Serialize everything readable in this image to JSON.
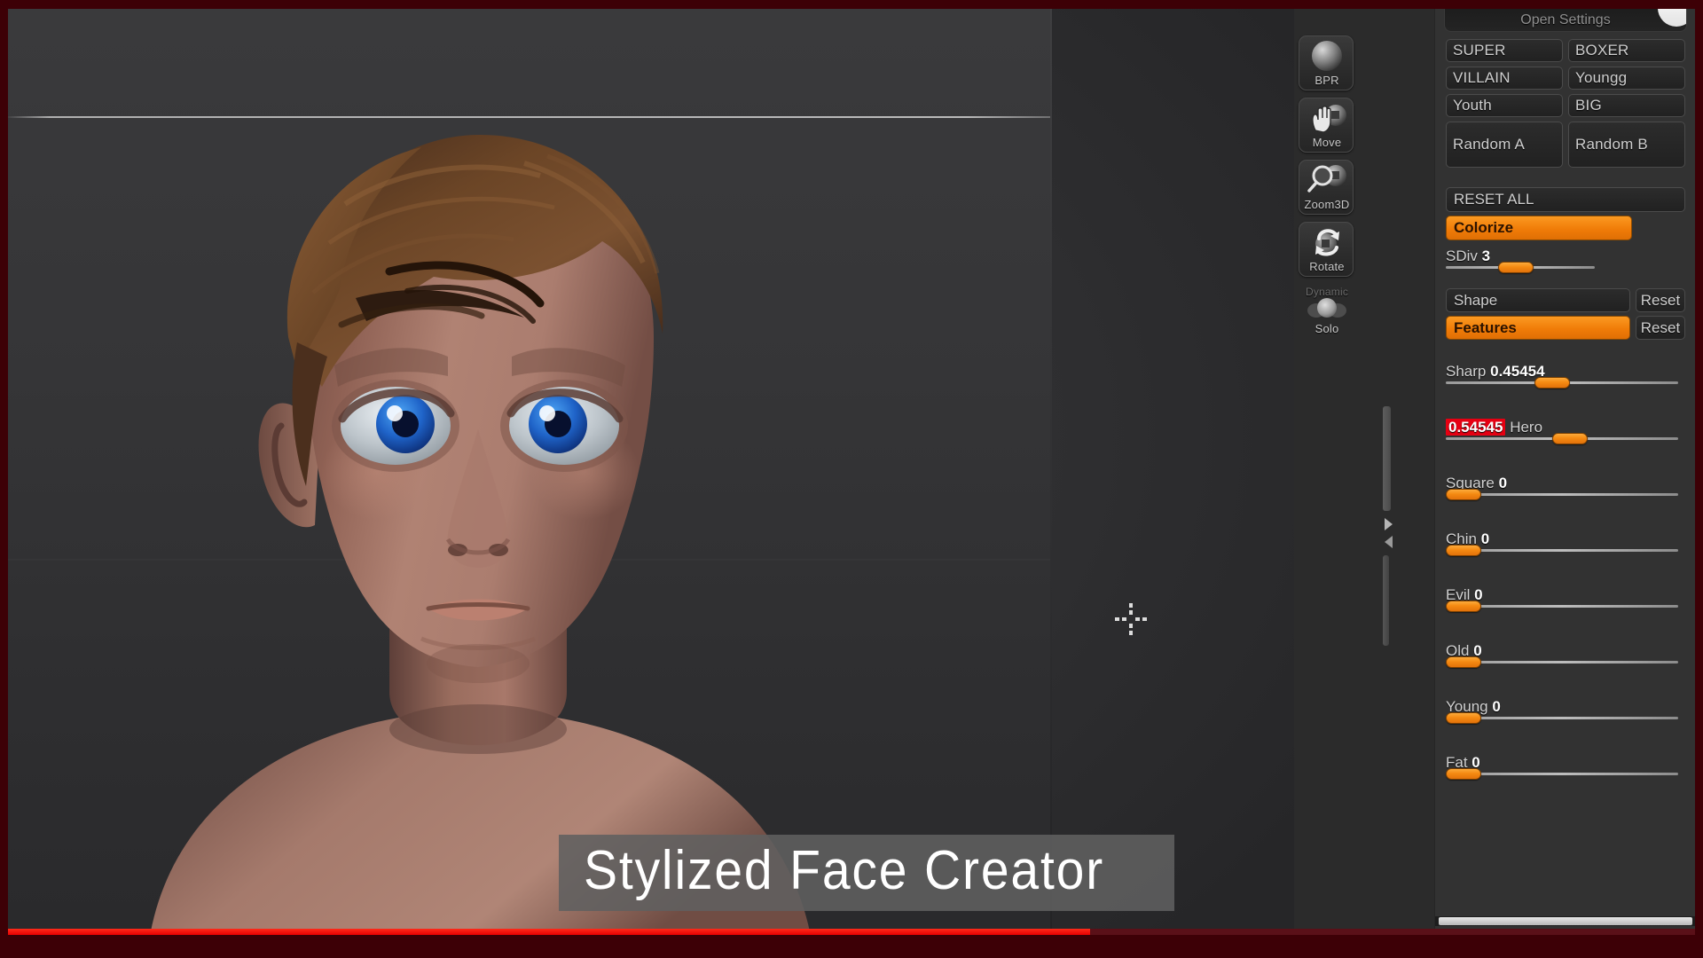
{
  "app": {
    "title": "Stylized Face Creator",
    "logo_icon": "zbrush-logo-icon"
  },
  "viewport": {
    "cursor_icon": "crosshair-cursor-icon",
    "scrollbar_icon": "viewport-scrollbar-arrows-icon"
  },
  "toolbar": {
    "items": [
      {
        "label": "BPR",
        "icon": "bpr-render-sphere-icon",
        "sublabel": ""
      },
      {
        "label": "Move",
        "icon": "move-hand-icon",
        "sublabel": ""
      },
      {
        "label": "Zoom3D",
        "icon": "zoom3d-magnifier-icon",
        "sublabel": ""
      },
      {
        "label": "Rotate",
        "icon": "rotate-arrows-icon",
        "sublabel": ""
      },
      {
        "label": "Solo",
        "icon": "dynamic-solo-spheres-icon",
        "sublabel": "Dynamic"
      }
    ]
  },
  "panel": {
    "open_settings_label": "Open Settings",
    "preset_buttons": [
      {
        "label": "SUPER"
      },
      {
        "label": "BOXER"
      },
      {
        "label": "VILLAIN"
      },
      {
        "label": "Youngg"
      },
      {
        "label": "Youth"
      },
      {
        "label": "BIG"
      }
    ],
    "random_buttons": [
      {
        "label": "Random A"
      },
      {
        "label": "Random B"
      }
    ],
    "reset_all_label": "RESET ALL",
    "colorize": {
      "label": "Colorize",
      "active": true
    },
    "sdiv": {
      "label": "SDiv",
      "value": "3",
      "percent": 46
    },
    "mode_rows": [
      {
        "label": "Shape",
        "active": false,
        "reset_label": "Reset"
      },
      {
        "label": "Features",
        "active": true,
        "reset_label": "Reset"
      }
    ],
    "sliders": [
      {
        "label": "Sharp",
        "value": "0.45454",
        "percent": 45,
        "value_first": false,
        "highlight": false
      },
      {
        "label": "Hero",
        "value": "0.54545",
        "percent": 54,
        "value_first": true,
        "highlight": true
      },
      {
        "label": "Square",
        "value": "0",
        "percent": 0,
        "value_first": false,
        "highlight": false
      },
      {
        "label": "Chin",
        "value": "0",
        "percent": 0,
        "value_first": false,
        "highlight": false
      },
      {
        "label": "Evil",
        "value": "0",
        "percent": 0,
        "value_first": false,
        "highlight": false
      },
      {
        "label": "Old",
        "value": "0",
        "percent": 0,
        "value_first": false,
        "highlight": false
      },
      {
        "label": "Young",
        "value": "0",
        "percent": 0,
        "value_first": false,
        "highlight": false
      },
      {
        "label": "Fat",
        "value": "0",
        "percent": 0,
        "value_first": false,
        "highlight": false
      }
    ]
  },
  "playback": {
    "progress_percent": 64,
    "bar_color": "#e60000",
    "remaining_color": "#d9d9d9"
  },
  "colors": {
    "accent_orange": "#f4780c",
    "panel_bg": "#323232",
    "viewport_bg": "#333335",
    "highlight_red": "#e60012",
    "frame_red": "#3d0006"
  }
}
